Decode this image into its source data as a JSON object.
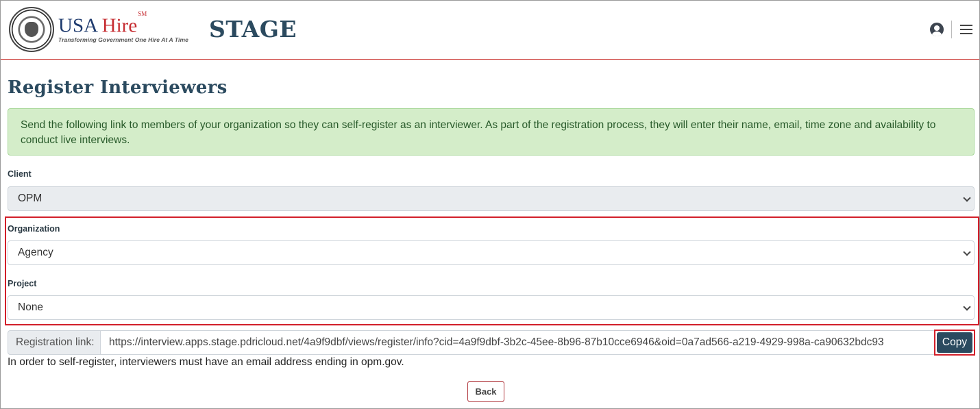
{
  "header": {
    "logo_usa": "USA",
    "logo_hire": "Hire",
    "logo_sm": "SM",
    "logo_tagline": "Transforming Government One Hire At A Time",
    "environment_label": "STAGE",
    "user_icon": "user-circle-icon",
    "menu_icon": "hamburger-menu-icon"
  },
  "page": {
    "title": "Register Interviewers",
    "alert_text": "Send the following link to members of your organization so they can self-register as an interviewer. As part of the registration process, they will enter their name, email, time zone and availability to conduct live interviews."
  },
  "form": {
    "client_label": "Client",
    "client_value": "OPM",
    "organization_label": "Organization",
    "organization_value": "Agency",
    "project_label": "Project",
    "project_value": "None",
    "registration_label": "Registration link:",
    "registration_url": "https://interview.apps.stage.pdricloud.net/4a9f9dbf/views/register/info?cid=4a9f9dbf-3b2c-45ee-8b96-87b10cce6946&oid=0a7ad566-a219-4929-998a-ca90632bdc93",
    "copy_label": "Copy",
    "note": "In order to self-register, interviewers must have an email address ending in opm.gov.",
    "back_label": "Back"
  },
  "colors": {
    "brand_navy": "#2b4a5f",
    "alert_bg": "#d4edc9",
    "highlight_red": "#d21f2a"
  }
}
